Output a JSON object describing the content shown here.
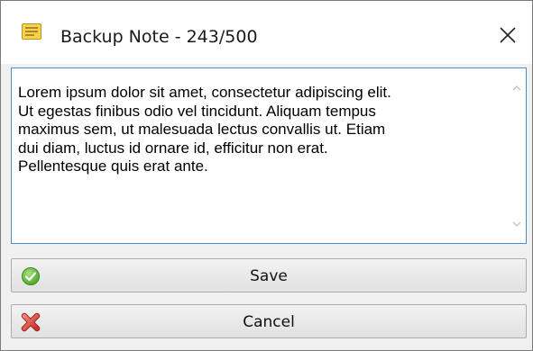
{
  "window": {
    "title": "Backup Note - 243/500",
    "icon": "note-icon",
    "close_icon": "close-icon"
  },
  "note": {
    "text": "Lorem ipsum dolor sit amet, consectetur adipiscing elit.\nUt egestas finibus odio vel tincidunt. Aliquam tempus\nmaximus sem, ut malesuada lectus convallis ut. Etiam\ndui diam, luctus id ornare id, efficitur non erat.\nPellentesque quis erat ante."
  },
  "buttons": {
    "save_label": "Save",
    "save_icon": "check-circle-icon",
    "cancel_label": "Cancel",
    "cancel_icon": "red-x-icon"
  },
  "colors": {
    "textarea_border": "#4f8dc9",
    "save_icon_green": "#5cb836",
    "cancel_icon_red": "#d9433a",
    "note_icon_yellow": "#f5d24a"
  }
}
